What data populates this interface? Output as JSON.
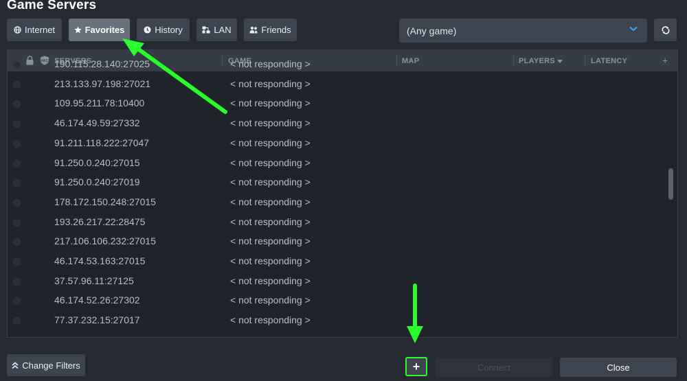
{
  "window": {
    "title": "Game Servers"
  },
  "tabs": [
    {
      "label": "Internet",
      "icon": "globe-icon"
    },
    {
      "label": "Favorites",
      "icon": "star-icon",
      "active": true
    },
    {
      "label": "History",
      "icon": "clock-icon"
    },
    {
      "label": "LAN",
      "icon": "lan-icon"
    },
    {
      "label": "Friends",
      "icon": "friends-icon"
    }
  ],
  "filter": {
    "game_value": "(Any game)"
  },
  "columns": {
    "servers": "SERVERS",
    "game": "GAME",
    "map": "MAP",
    "players": "PLAYERS",
    "latency": "LATENCY",
    "add": "+"
  },
  "servers": [
    {
      "address": "190.115.28.140:27025",
      "game": "< not responding >"
    },
    {
      "address": "213.133.97.198:27021",
      "game": "< not responding >"
    },
    {
      "address": "109.95.211.78:10400",
      "game": "< not responding >"
    },
    {
      "address": "46.174.49.59:27332",
      "game": "< not responding >"
    },
    {
      "address": "91.211.118.222:27047",
      "game": "< not responding >"
    },
    {
      "address": "91.250.0.240:27015",
      "game": "< not responding >"
    },
    {
      "address": "91.250.0.240:27019",
      "game": "< not responding >"
    },
    {
      "address": "178.172.150.248:27015",
      "game": "< not responding >"
    },
    {
      "address": "193.26.217.22:28475",
      "game": "< not responding >"
    },
    {
      "address": "217.106.106.232:27015",
      "game": "< not responding >"
    },
    {
      "address": "46.174.53.163:27015",
      "game": "< not responding >"
    },
    {
      "address": "37.57.96.11:27125",
      "game": "< not responding >"
    },
    {
      "address": "46.174.52.26:27302",
      "game": "< not responding >"
    },
    {
      "address": "77.37.232.15:27017",
      "game": "< not responding >"
    }
  ],
  "footer": {
    "change_filters": "Change Filters",
    "add_server": "+",
    "connect": "Connect",
    "close": "Close"
  },
  "colors": {
    "background": "#262a33",
    "button": "#3d4450",
    "active_tab": "#67707b",
    "highlight": "#2bff2b"
  }
}
